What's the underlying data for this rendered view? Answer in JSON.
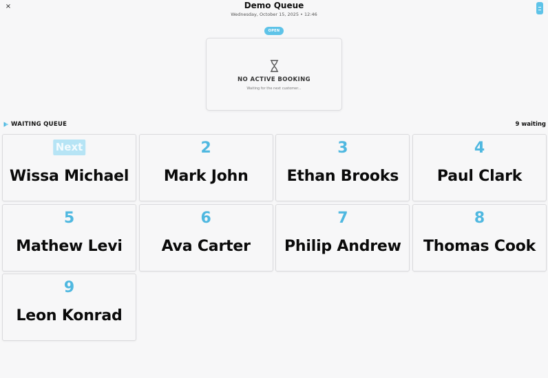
{
  "header": {
    "title": "Demo Queue",
    "subtitle": "Wednesday, October 15, 2025 • 12:46",
    "status": "OPEN",
    "close_icon": "×"
  },
  "booking": {
    "icon": "hourglass-icon",
    "title": "NO ACTIVE BOOKING",
    "subtitle": "Waiting for the next customer..."
  },
  "queue": {
    "title": "WAITING QUEUE",
    "count_label": "9 waiting",
    "items": [
      {
        "position": "Next",
        "name": "Wissa Michael"
      },
      {
        "position": "2",
        "name": "Mark John"
      },
      {
        "position": "3",
        "name": "Ethan Brooks"
      },
      {
        "position": "4",
        "name": "Paul Clark"
      },
      {
        "position": "5",
        "name": "Mathew Levi"
      },
      {
        "position": "6",
        "name": "Ava Carter"
      },
      {
        "position": "7",
        "name": "Philip Andrew"
      },
      {
        "position": "8",
        "name": "Thomas Cook"
      },
      {
        "position": "9",
        "name": "Leon Konrad"
      }
    ]
  },
  "colors": {
    "accent": "#5ec3e8",
    "number": "#4fb8e0",
    "next_badge": "#b6e4f5"
  }
}
